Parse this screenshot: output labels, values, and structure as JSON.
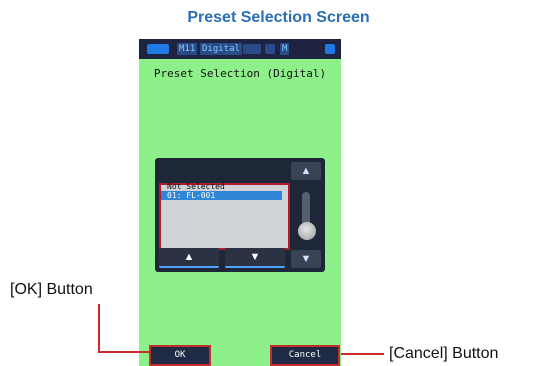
{
  "figure": {
    "title": "Preset Selection Screen"
  },
  "status_bar": {
    "mode": "M11",
    "type": "Digital",
    "indicator": "M"
  },
  "screen": {
    "title": "Preset Selection (Digital)"
  },
  "list": {
    "rows": [
      "Not Selected",
      "01: FL-001"
    ],
    "selected_index": 1
  },
  "controls": {
    "scroll_top_icon": "▲",
    "scroll_bottom_icon": "▼",
    "up_icon": "▲",
    "down_icon": "▼"
  },
  "buttons": {
    "ok": "OK",
    "cancel": "Cancel"
  },
  "callouts": {
    "ok": "[OK] Button",
    "cancel": "[Cancel] Button"
  },
  "colors": {
    "accent_red": "#c82b2b",
    "screen_green": "#8ef08a",
    "title_blue": "#2b6fb3"
  }
}
